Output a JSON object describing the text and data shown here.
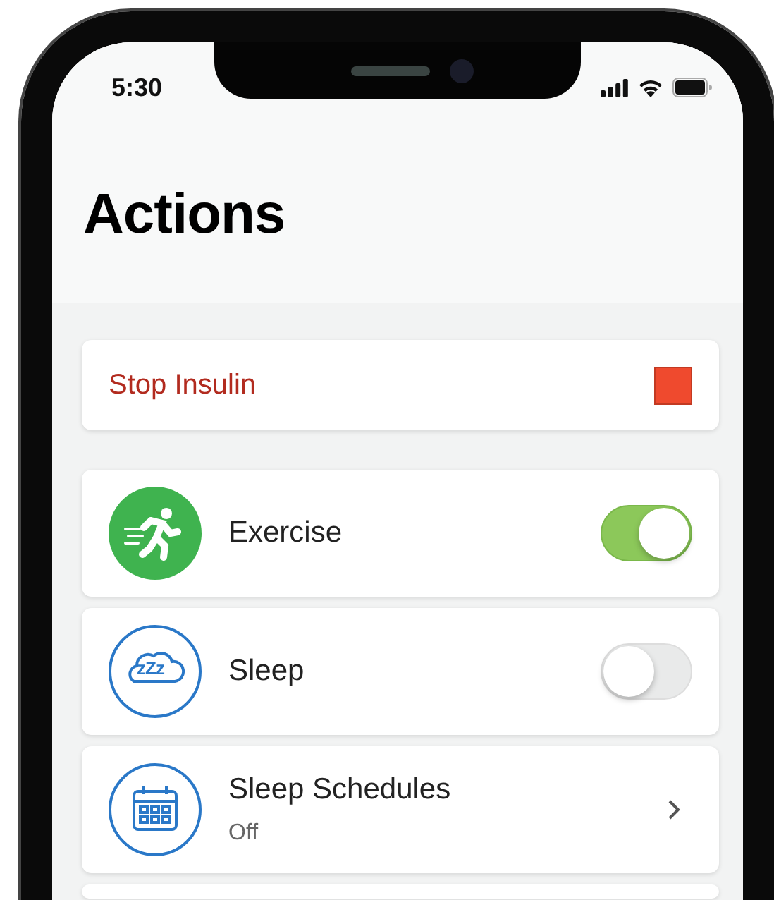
{
  "status_bar": {
    "time": "5:30"
  },
  "title": "Actions",
  "stop_card": {
    "label": "Stop Insulin"
  },
  "actions": [
    {
      "kind": "toggle",
      "label": "Exercise",
      "on": true
    },
    {
      "kind": "toggle",
      "icon_text": "zZz",
      "label": "Sleep",
      "on": false
    },
    {
      "kind": "link",
      "label": "Sleep Schedules",
      "detail": "Off"
    }
  ]
}
